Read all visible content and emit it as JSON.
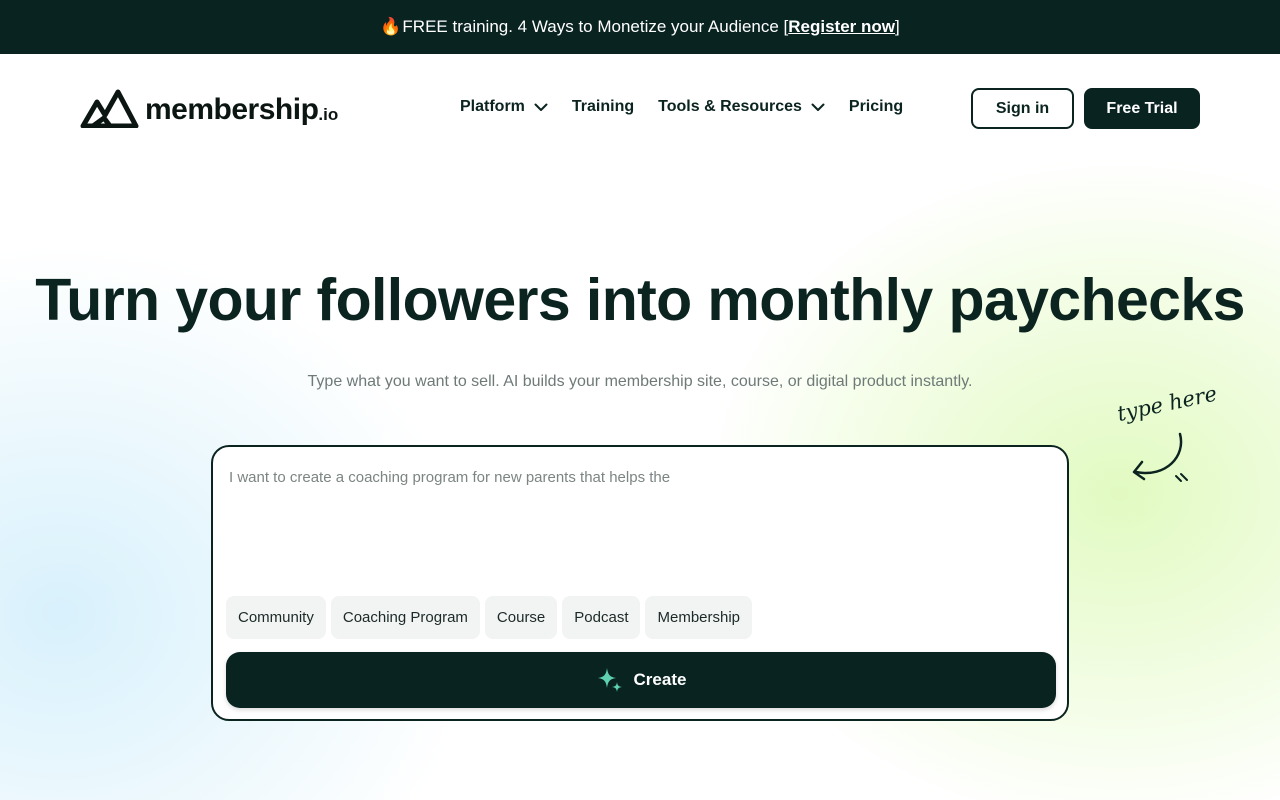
{
  "promo": {
    "prefix": "FREE training. 4 Ways to Monetize your Audience [",
    "link_label": "Register now",
    "suffix": "]"
  },
  "brand": {
    "name": "membership",
    "tld": ".io"
  },
  "nav": {
    "items": [
      {
        "label": "Platform",
        "dropdown": true
      },
      {
        "label": "Training",
        "dropdown": false
      },
      {
        "label": "Tools & Resources",
        "dropdown": true
      },
      {
        "label": "Pricing",
        "dropdown": false
      }
    ],
    "signin_label": "Sign in",
    "trial_label": "Free Trial"
  },
  "hero": {
    "title": "Turn your followers into monthly paychecks",
    "subtitle": "Type what you want to sell. AI builds your membership site, course, or digital product instantly.",
    "annotation": "type here"
  },
  "composer": {
    "placeholder": "I want to create a coaching program for new parents that helps the",
    "chips": [
      "Community",
      "Coaching Program",
      "Course",
      "Podcast",
      "Membership"
    ],
    "create_label": "Create"
  },
  "colors": {
    "primary_dark": "#082320",
    "text_dark": "#0b2420",
    "muted_text": "#6f7a78",
    "chip_bg": "#f2f3f3",
    "spark_teal": "#5fd0b0"
  },
  "icons": {
    "promo": "fire-icon",
    "logo": "mountain-logo-icon",
    "dropdown": "chevron-down-icon",
    "annotation": "curved-arrow-icon",
    "create": "sparkle-icon"
  }
}
